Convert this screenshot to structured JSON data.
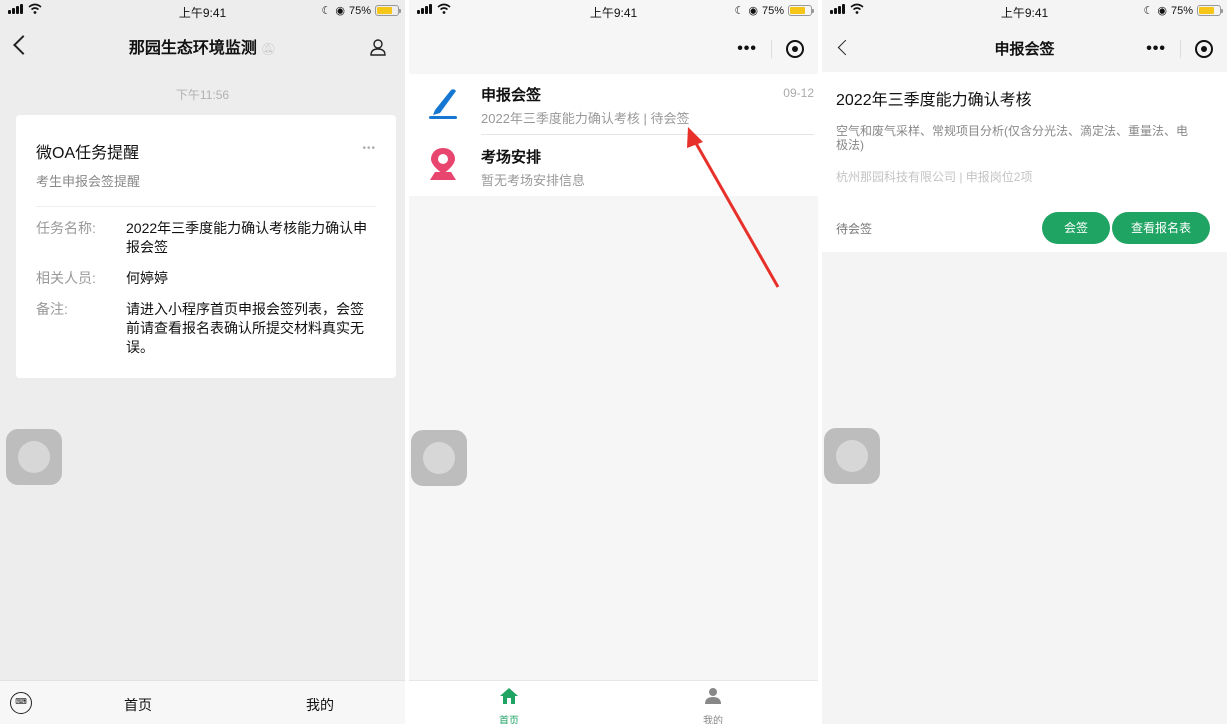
{
  "status_bar": {
    "time": "上午9:41",
    "battery": "75%"
  },
  "panel1": {
    "nav_title": "那园生态环境监测",
    "msg_time": "下午11:56",
    "card": {
      "title": "微OA任务提醒",
      "subtitle": "考生申报会签提醒",
      "more": "•••",
      "rows": [
        {
          "key": "任务名称:",
          "value": "2022年三季度能力确认考核能力确认申报会签"
        },
        {
          "key": "相关人员:",
          "value": "何婷婷"
        },
        {
          "key": "备注:",
          "value": "请进入小程序首页申报会签列表，会签前请查看报名表确认所提交材料真实无误。"
        }
      ]
    },
    "tabbar": {
      "home": "首页",
      "mine": "我的"
    }
  },
  "panel2": {
    "items": [
      {
        "title": "申报会签",
        "subtitle": "2022年三季度能力确认考核 | 待会签",
        "date": "09-12",
        "icon": "pen-icon"
      },
      {
        "title": "考场安排",
        "subtitle": "暂无考场安排信息",
        "date": "",
        "icon": "location-icon"
      }
    ],
    "tabbar": {
      "home": "首页",
      "mine": "我的"
    },
    "accent": "#1fa463"
  },
  "panel3": {
    "nav_title": "申报会签",
    "heading": "2022年三季度能力确认考核",
    "description": "空气和废气采样、常规项目分析(仅含分光法、滴定法、重量法、电极法)",
    "company": "杭州那园科技有限公司  |  申报岗位2项",
    "status": "待会签",
    "buttons": {
      "sign": "会签",
      "view": "查看报名表"
    }
  }
}
